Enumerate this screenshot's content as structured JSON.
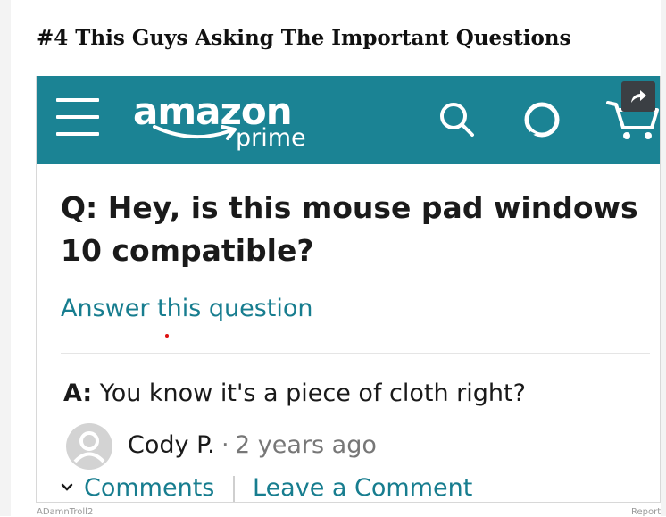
{
  "post": {
    "title": "#4 This Guys Asking The Important Questions"
  },
  "amazon": {
    "brand_color": "#1b8394",
    "logo_text": "amazon",
    "logo_subtext": "prime",
    "icons": [
      "menu-icon",
      "search-icon",
      "alexa-icon",
      "cart-icon",
      "share-icon"
    ]
  },
  "qa": {
    "question": "Q: Hey, is this mouse pad windows 10 compatible?",
    "answer_link": "Answer this question",
    "answer_prefix": "A:",
    "answer_text": "You know it's a piece of cloth right?",
    "author": "Cody P.",
    "separator": "·",
    "time": "2 years ago",
    "comments_label": "Comments",
    "leave_comment_label": "Leave a Comment",
    "link_color": "#177d8f"
  },
  "footer": {
    "user": "ADamnTroll2",
    "report": "Report"
  }
}
